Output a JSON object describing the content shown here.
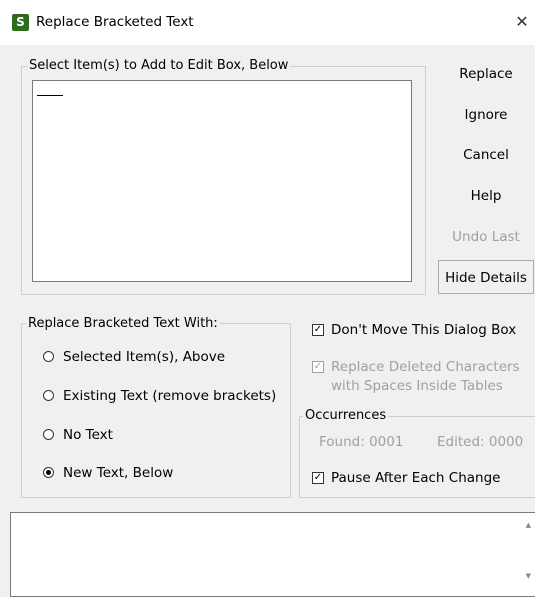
{
  "window": {
    "title": "Replace Bracketed Text",
    "close_glyph": "✕"
  },
  "select_group": {
    "label": "Select Item(s) to Add to Edit Box, Below"
  },
  "buttons": {
    "replace": "Replace",
    "ignore": "Ignore",
    "cancel": "Cancel",
    "help": "Help",
    "undo_last": "Undo Last",
    "hide_details": "Hide Details"
  },
  "replace_with": {
    "label": "Replace Bracketed Text With:",
    "options": [
      {
        "label": "Selected Item(s), Above",
        "checked": false
      },
      {
        "label": "Existing Text (remove brackets)",
        "checked": false
      },
      {
        "label": "No Text",
        "checked": false
      },
      {
        "label": "New Text, Below",
        "checked": true
      }
    ]
  },
  "options": {
    "dont_move": "Don't Move This Dialog Box",
    "replace_deleted_line1": "Replace Deleted Characters",
    "replace_deleted_line2": "with Spaces Inside Tables",
    "pause_after": "Pause After Each Change"
  },
  "occurrences": {
    "label": "Occurrences",
    "found": "Found: 0001",
    "edited": "Edited: 0000"
  }
}
